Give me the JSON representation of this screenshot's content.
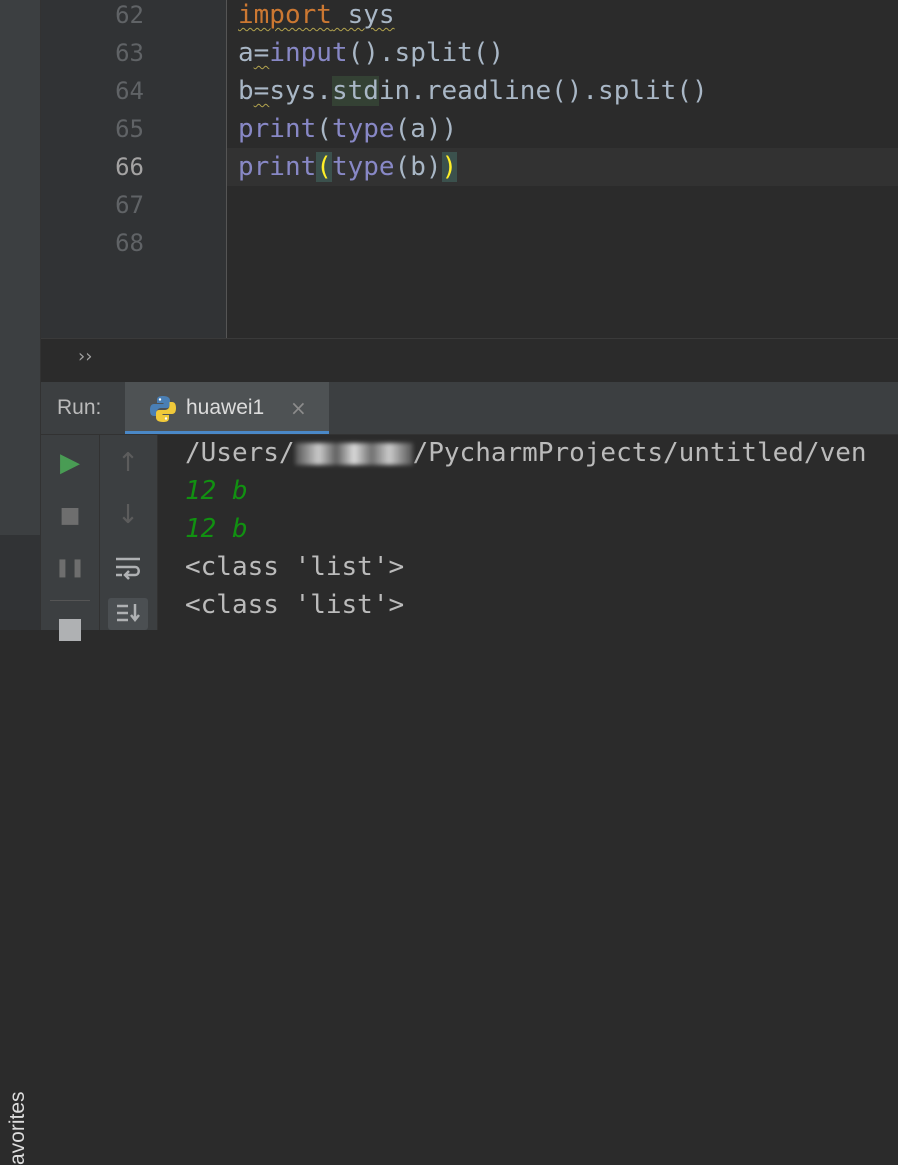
{
  "editor": {
    "line_numbers": [
      "62",
      "63",
      "64",
      "65",
      "66",
      "67",
      "68"
    ],
    "current_line": "66",
    "lines": {
      "l62": {
        "keyword": "import",
        "rest": " sys"
      },
      "l63": {
        "a": "a",
        "eq": "=",
        "fn": "input",
        "rest": "().split()"
      },
      "l64": {
        "b": "b",
        "eq": "=",
        "pre": "sys.",
        "hl": "std",
        "rest": "in.readline().split()"
      },
      "l65": {
        "fn1": "print",
        "p1": "(",
        "fn2": "type",
        "rest": "(a))"
      },
      "l66": {
        "fn1": "print",
        "open": "(",
        "fn2": "type",
        "mid": "(b)",
        "close": ")"
      }
    }
  },
  "breadcrumb": {
    "arrows": "››"
  },
  "run_panel": {
    "label": "Run:",
    "tab_name": "huawei1",
    "tab_close": "×",
    "tab_icon": "python-icon"
  },
  "toolbar": {
    "rerun": "▶",
    "stop": "■",
    "pause": "❚❚",
    "up": "↑",
    "down": "↓",
    "wrap": "wrap-icon",
    "scroll_end": "scroll-to-end-icon"
  },
  "console": {
    "path_prefix": "/Users/",
    "path_suffix": "/PycharmProjects/untitled/ven",
    "lines": [
      "12 b",
      "12 b",
      "<class 'list'>",
      "<class 'list'>"
    ]
  },
  "sidebar": {
    "favorites": "avorites"
  },
  "colors": {
    "accent": "#4a88c7",
    "keyword": "#cc7832",
    "builtin": "#8888c6",
    "input_text": "#119111",
    "run_green": "#499c54"
  }
}
